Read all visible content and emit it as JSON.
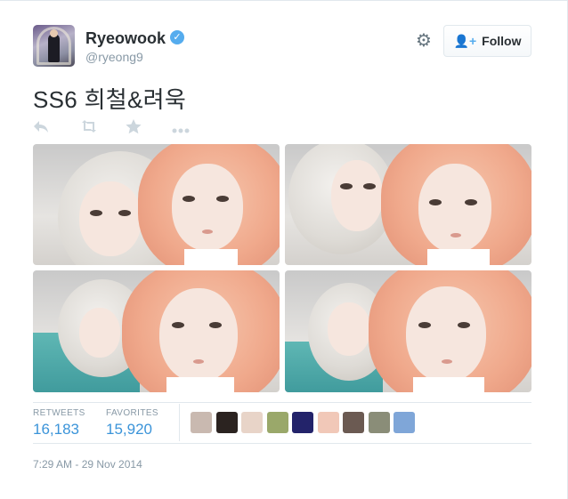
{
  "user": {
    "name": "Ryeowook",
    "handle": "@ryeong9",
    "verified_icon": "verified-badge-icon"
  },
  "header": {
    "follow_label": "Follow",
    "follow_icon": "add-user-icon",
    "settings_icon": "gear-icon"
  },
  "tweet": {
    "text": "SS6 희철&려욱",
    "photos": [
      "photo-1",
      "photo-2",
      "photo-3",
      "photo-4"
    ],
    "actions": [
      "reply-icon",
      "retweet-icon",
      "favorite-icon",
      "more-icon"
    ]
  },
  "stats": {
    "retweets_label": "RETWEETS",
    "retweets_value": "16,183",
    "favorites_label": "FAVORITES",
    "favorites_value": "15,920"
  },
  "favoriters": [
    {
      "name": "favoriter-avatar-1",
      "color": "#c9b9b0"
    },
    {
      "name": "favoriter-avatar-2",
      "color": "#2b2320"
    },
    {
      "name": "favoriter-avatar-3",
      "color": "#e8d4c8"
    },
    {
      "name": "favoriter-avatar-4",
      "color": "#9aa86a"
    },
    {
      "name": "favoriter-avatar-5",
      "color": "#23236a"
    },
    {
      "name": "favoriter-avatar-6",
      "color": "#f1c8b8"
    },
    {
      "name": "favoriter-avatar-7",
      "color": "#6b5a52"
    },
    {
      "name": "favoriter-avatar-8",
      "color": "#8a8d78"
    },
    {
      "name": "favoriter-avatar-9",
      "color": "#7fa6d8"
    }
  ],
  "timestamp": "7:29 AM - 29 Nov 2014",
  "colors": {
    "accent": "#55acee",
    "link": "#3b94d9",
    "muted": "#8899a6"
  }
}
